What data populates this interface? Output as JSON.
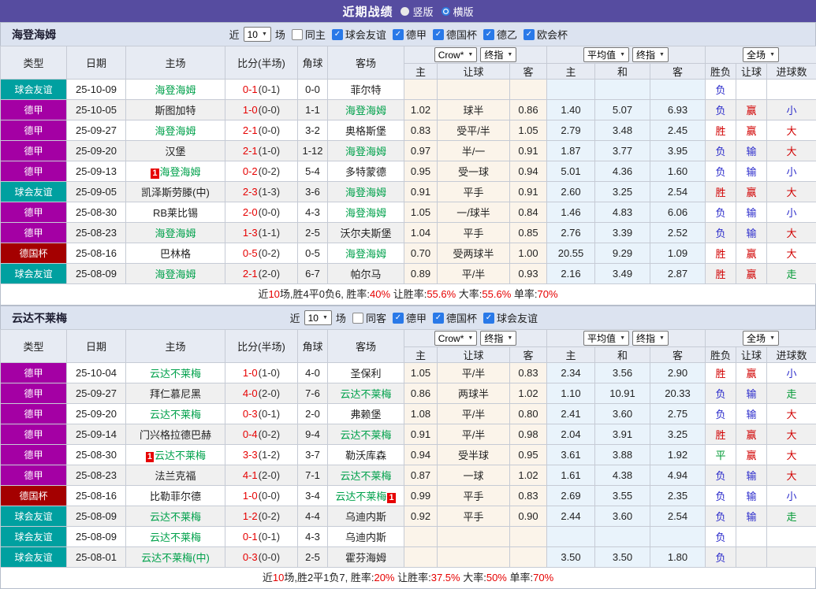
{
  "title_bar": {
    "title": "近期战绩",
    "options": [
      {
        "label": "竖版",
        "selected": false
      },
      {
        "label": "横版",
        "selected": true
      }
    ]
  },
  "columns": {
    "widths": [
      84,
      75,
      126,
      92,
      38,
      97,
      42,
      92,
      47,
      61,
      70,
      70,
      39,
      39,
      63
    ]
  },
  "header": {
    "main": [
      "类型",
      "日期",
      "主场",
      "比分(半场)",
      "角球",
      "客场"
    ],
    "sub": [
      "主",
      "让球",
      "客",
      "主",
      "和",
      "客",
      "胜负",
      "让球",
      "进球数"
    ],
    "selects": {
      "company": "Crow*",
      "final": "终指",
      "average": "平均值",
      "full": "全场"
    }
  },
  "filters_labels": {
    "near": "近",
    "unit": "场"
  },
  "colors": {
    "accent": "#564CA0",
    "section_header_bg": "#DCE3F0",
    "type": {
      "球会友谊": "#00A0A0",
      "德甲": "#A400A4",
      "德国杯": "#A40000"
    },
    "result": {
      "胜": "#D10000",
      "负": "#2B2BCB",
      "平": "#009933",
      "赢": "#D10000",
      "输": "#2B2BCB",
      "大": "#D10000",
      "小": "#2B2BCB",
      "走": "#009933"
    },
    "self_team": "#00A14B",
    "score": "#E60000",
    "badge_bg": "#E60000"
  },
  "sections": [
    {
      "team": "海登海姆",
      "filters": {
        "rounds": "10",
        "same": {
          "label": "同主",
          "checked": false
        },
        "leagues": [
          {
            "label": "球会友谊",
            "checked": true
          },
          {
            "label": "德甲",
            "checked": true
          },
          {
            "label": "德国杯",
            "checked": true
          },
          {
            "label": "德乙",
            "checked": true
          },
          {
            "label": "欧会杯",
            "checked": true
          }
        ]
      },
      "rows": [
        {
          "type": "球会友谊",
          "date": "25-10-09",
          "home": "海登海姆",
          "home_self": true,
          "home_badge": "",
          "score": "0-1",
          "half": "(0-1)",
          "corner": "0-0",
          "away": "菲尔特",
          "away_self": false,
          "away_badge": "",
          "odds": [
            "",
            "",
            ""
          ],
          "avg": [
            "",
            "",
            ""
          ],
          "results": [
            "负",
            "",
            ""
          ]
        },
        {
          "type": "德甲",
          "date": "25-10-05",
          "home": "斯图加特",
          "home_self": false,
          "home_badge": "",
          "score": "1-0",
          "half": "(0-0)",
          "corner": "1-1",
          "away": "海登海姆",
          "away_self": true,
          "away_badge": "",
          "odds": [
            "1.02",
            "球半",
            "0.86"
          ],
          "avg": [
            "1.40",
            "5.07",
            "6.93"
          ],
          "results": [
            "负",
            "赢",
            "小"
          ]
        },
        {
          "type": "德甲",
          "date": "25-09-27",
          "home": "海登海姆",
          "home_self": true,
          "home_badge": "",
          "score": "2-1",
          "half": "(0-0)",
          "corner": "3-2",
          "away": "奥格斯堡",
          "away_self": false,
          "away_badge": "",
          "odds": [
            "0.83",
            "受平/半",
            "1.05"
          ],
          "avg": [
            "2.79",
            "3.48",
            "2.45"
          ],
          "results": [
            "胜",
            "赢",
            "大"
          ]
        },
        {
          "type": "德甲",
          "date": "25-09-20",
          "home": "汉堡",
          "home_self": false,
          "home_badge": "",
          "score": "2-1",
          "half": "(1-0)",
          "corner": "1-12",
          "away": "海登海姆",
          "away_self": true,
          "away_badge": "",
          "odds": [
            "0.97",
            "半/一",
            "0.91"
          ],
          "avg": [
            "1.87",
            "3.77",
            "3.95"
          ],
          "results": [
            "负",
            "输",
            "大"
          ]
        },
        {
          "type": "德甲",
          "date": "25-09-13",
          "home": "海登海姆",
          "home_self": true,
          "home_badge": "1",
          "score": "0-2",
          "half": "(0-2)",
          "corner": "5-4",
          "away": "多特蒙德",
          "away_self": false,
          "away_badge": "",
          "odds": [
            "0.95",
            "受一球",
            "0.94"
          ],
          "avg": [
            "5.01",
            "4.36",
            "1.60"
          ],
          "results": [
            "负",
            "输",
            "小"
          ]
        },
        {
          "type": "球会友谊",
          "date": "25-09-05",
          "home": "凯泽斯劳滕(中)",
          "home_self": false,
          "home_badge": "",
          "score": "2-3",
          "half": "(1-3)",
          "corner": "3-6",
          "away": "海登海姆",
          "away_self": true,
          "away_badge": "",
          "odds": [
            "0.91",
            "平手",
            "0.91"
          ],
          "avg": [
            "2.60",
            "3.25",
            "2.54"
          ],
          "results": [
            "胜",
            "赢",
            "大"
          ]
        },
        {
          "type": "德甲",
          "date": "25-08-30",
          "home": "RB莱比锡",
          "home_self": false,
          "home_badge": "",
          "score": "2-0",
          "half": "(0-0)",
          "corner": "4-3",
          "away": "海登海姆",
          "away_self": true,
          "away_badge": "",
          "odds": [
            "1.05",
            "一/球半",
            "0.84"
          ],
          "avg": [
            "1.46",
            "4.83",
            "6.06"
          ],
          "results": [
            "负",
            "输",
            "小"
          ]
        },
        {
          "type": "德甲",
          "date": "25-08-23",
          "home": "海登海姆",
          "home_self": true,
          "home_badge": "",
          "score": "1-3",
          "half": "(1-1)",
          "corner": "2-5",
          "away": "沃尔夫斯堡",
          "away_self": false,
          "away_badge": "",
          "odds": [
            "1.04",
            "平手",
            "0.85"
          ],
          "avg": [
            "2.76",
            "3.39",
            "2.52"
          ],
          "results": [
            "负",
            "输",
            "大"
          ]
        },
        {
          "type": "德国杯",
          "date": "25-08-16",
          "home": "巴林格",
          "home_self": false,
          "home_badge": "",
          "score": "0-5",
          "half": "(0-2)",
          "corner": "0-5",
          "away": "海登海姆",
          "away_self": true,
          "away_badge": "",
          "odds": [
            "0.70",
            "受两球半",
            "1.00"
          ],
          "avg": [
            "20.55",
            "9.29",
            "1.09"
          ],
          "results": [
            "胜",
            "赢",
            "大"
          ]
        },
        {
          "type": "球会友谊",
          "date": "25-08-09",
          "home": "海登海姆",
          "home_self": true,
          "home_badge": "",
          "score": "2-1",
          "half": "(2-0)",
          "corner": "6-7",
          "away": "帕尔马",
          "away_self": false,
          "away_badge": "",
          "odds": [
            "0.89",
            "平/半",
            "0.93"
          ],
          "avg": [
            "2.16",
            "3.49",
            "2.87"
          ],
          "results": [
            "胜",
            "赢",
            "走"
          ]
        }
      ],
      "summary": [
        {
          "t": "近"
        },
        {
          "t": "10",
          "red": true
        },
        {
          "t": "场,胜4平0负6, 胜率:"
        },
        {
          "t": "40%",
          "red": true
        },
        {
          "t": " 让胜率:"
        },
        {
          "t": "55.6%",
          "red": true
        },
        {
          "t": " 大率:"
        },
        {
          "t": "55.6%",
          "red": true
        },
        {
          "t": " 单率:"
        },
        {
          "t": "70%",
          "red": true
        }
      ]
    },
    {
      "team": "云达不莱梅",
      "filters": {
        "rounds": "10",
        "same": {
          "label": "同客",
          "checked": false
        },
        "leagues": [
          {
            "label": "德甲",
            "checked": true
          },
          {
            "label": "德国杯",
            "checked": true
          },
          {
            "label": "球会友谊",
            "checked": true
          }
        ]
      },
      "rows": [
        {
          "type": "德甲",
          "date": "25-10-04",
          "home": "云达不莱梅",
          "home_self": true,
          "home_badge": "",
          "score": "1-0",
          "half": "(1-0)",
          "corner": "4-0",
          "away": "圣保利",
          "away_self": false,
          "away_badge": "",
          "odds": [
            "1.05",
            "平/半",
            "0.83"
          ],
          "avg": [
            "2.34",
            "3.56",
            "2.90"
          ],
          "results": [
            "胜",
            "赢",
            "小"
          ]
        },
        {
          "type": "德甲",
          "date": "25-09-27",
          "home": "拜仁慕尼黑",
          "home_self": false,
          "home_badge": "",
          "score": "4-0",
          "half": "(2-0)",
          "corner": "7-6",
          "away": "云达不莱梅",
          "away_self": true,
          "away_badge": "",
          "odds": [
            "0.86",
            "两球半",
            "1.02"
          ],
          "avg": [
            "1.10",
            "10.91",
            "20.33"
          ],
          "results": [
            "负",
            "输",
            "走"
          ]
        },
        {
          "type": "德甲",
          "date": "25-09-20",
          "home": "云达不莱梅",
          "home_self": true,
          "home_badge": "",
          "score": "0-3",
          "half": "(0-1)",
          "corner": "2-0",
          "away": "弗赖堡",
          "away_self": false,
          "away_badge": "",
          "odds": [
            "1.08",
            "平/半",
            "0.80"
          ],
          "avg": [
            "2.41",
            "3.60",
            "2.75"
          ],
          "results": [
            "负",
            "输",
            "大"
          ]
        },
        {
          "type": "德甲",
          "date": "25-09-14",
          "home": "门兴格拉德巴赫",
          "home_self": false,
          "home_badge": "",
          "score": "0-4",
          "half": "(0-2)",
          "corner": "9-4",
          "away": "云达不莱梅",
          "away_self": true,
          "away_badge": "",
          "odds": [
            "0.91",
            "平/半",
            "0.98"
          ],
          "avg": [
            "2.04",
            "3.91",
            "3.25"
          ],
          "results": [
            "胜",
            "赢",
            "大"
          ]
        },
        {
          "type": "德甲",
          "date": "25-08-30",
          "home": "云达不莱梅",
          "home_self": true,
          "home_badge": "1",
          "score": "3-3",
          "half": "(1-2)",
          "corner": "3-7",
          "away": "勒沃库森",
          "away_self": false,
          "away_badge": "",
          "odds": [
            "0.94",
            "受半球",
            "0.95"
          ],
          "avg": [
            "3.61",
            "3.88",
            "1.92"
          ],
          "results": [
            "平",
            "赢",
            "大"
          ]
        },
        {
          "type": "德甲",
          "date": "25-08-23",
          "home": "法兰克福",
          "home_self": false,
          "home_badge": "",
          "score": "4-1",
          "half": "(2-0)",
          "corner": "7-1",
          "away": "云达不莱梅",
          "away_self": true,
          "away_badge": "",
          "odds": [
            "0.87",
            "一球",
            "1.02"
          ],
          "avg": [
            "1.61",
            "4.38",
            "4.94"
          ],
          "results": [
            "负",
            "输",
            "大"
          ]
        },
        {
          "type": "德国杯",
          "date": "25-08-16",
          "home": "比勒菲尔德",
          "home_self": false,
          "home_badge": "",
          "score": "1-0",
          "half": "(0-0)",
          "corner": "3-4",
          "away": "云达不莱梅",
          "away_self": true,
          "away_badge": "1",
          "odds": [
            "0.99",
            "平手",
            "0.83"
          ],
          "avg": [
            "2.69",
            "3.55",
            "2.35"
          ],
          "results": [
            "负",
            "输",
            "小"
          ]
        },
        {
          "type": "球会友谊",
          "date": "25-08-09",
          "home": "云达不莱梅",
          "home_self": true,
          "home_badge": "",
          "score": "1-2",
          "half": "(0-2)",
          "corner": "4-4",
          "away": "乌迪内斯",
          "away_self": false,
          "away_badge": "",
          "odds": [
            "0.92",
            "平手",
            "0.90"
          ],
          "avg": [
            "2.44",
            "3.60",
            "2.54"
          ],
          "results": [
            "负",
            "输",
            "走"
          ]
        },
        {
          "type": "球会友谊",
          "date": "25-08-09",
          "home": "云达不莱梅",
          "home_self": true,
          "home_badge": "",
          "score": "0-1",
          "half": "(0-1)",
          "corner": "4-3",
          "away": "乌迪内斯",
          "away_self": false,
          "away_badge": "",
          "odds": [
            "",
            "",
            ""
          ],
          "avg": [
            "",
            "",
            ""
          ],
          "results": [
            "负",
            "",
            ""
          ]
        },
        {
          "type": "球会友谊",
          "date": "25-08-01",
          "home": "云达不莱梅(中)",
          "home_self": true,
          "home_badge": "",
          "score": "0-3",
          "half": "(0-0)",
          "corner": "2-5",
          "away": "霍芬海姆",
          "away_self": false,
          "away_badge": "",
          "odds": [
            "",
            "",
            ""
          ],
          "avg": [
            "3.50",
            "3.50",
            "1.80"
          ],
          "results": [
            "负",
            "",
            ""
          ]
        }
      ],
      "summary": [
        {
          "t": "近"
        },
        {
          "t": "10",
          "red": true
        },
        {
          "t": "场,胜2平1负7, 胜率:"
        },
        {
          "t": "20%",
          "red": true
        },
        {
          "t": " 让胜率:"
        },
        {
          "t": "37.5%",
          "red": true
        },
        {
          "t": " 大率:"
        },
        {
          "t": "50%",
          "red": true
        },
        {
          "t": " 单率:"
        },
        {
          "t": "70%",
          "red": true
        }
      ]
    }
  ]
}
